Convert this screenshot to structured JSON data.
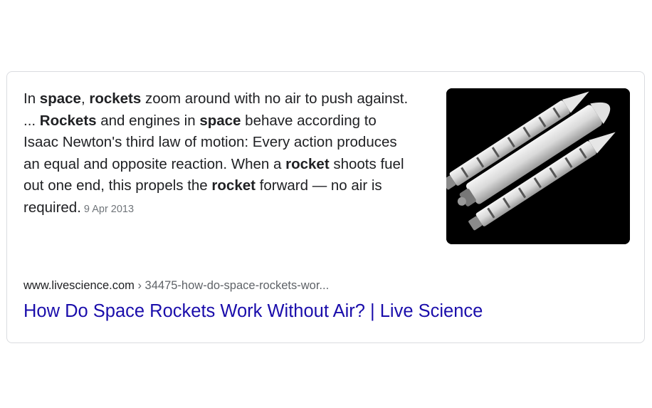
{
  "result": {
    "snippet": [
      {
        "text": "In ",
        "bold": false
      },
      {
        "text": "space",
        "bold": true
      },
      {
        "text": ", ",
        "bold": false
      },
      {
        "text": "rockets",
        "bold": true
      },
      {
        "text": " zoom around with no air to push against. ... ",
        "bold": false
      },
      {
        "text": "Rockets",
        "bold": true
      },
      {
        "text": " and engines in ",
        "bold": false
      },
      {
        "text": "space",
        "bold": true
      },
      {
        "text": " behave according to Isaac Newton's third law of motion: Every action produces an equal and opposite reaction. When a ",
        "bold": false
      },
      {
        "text": "rocket",
        "bold": true
      },
      {
        "text": " shoots fuel out one end, this propels the ",
        "bold": false
      },
      {
        "text": "rocket",
        "bold": true
      },
      {
        "text": " forward — no air is required.",
        "bold": false
      }
    ],
    "date": "9 Apr 2013",
    "cite_domain": "www.livescience.com",
    "cite_path": " › 34475-how-do-space-rockets-wor...",
    "title": "How Do Space Rockets Work Without Air? | Live Science",
    "thumbnail_icon": "space-shuttle-rocket-image",
    "colors": {
      "link": "#1a0dab",
      "text": "#202124",
      "muted": "#70757a",
      "border": "#dadce0"
    }
  }
}
